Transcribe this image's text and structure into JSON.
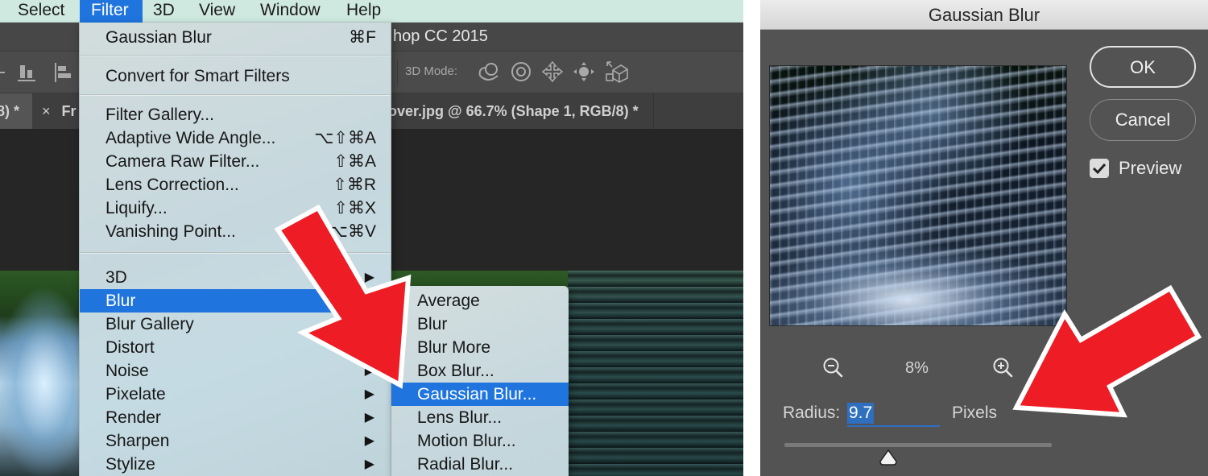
{
  "photoshop": {
    "menubar": {
      "items": [
        {
          "label": "Select",
          "active": false
        },
        {
          "label": "Filter",
          "active": true
        },
        {
          "label": "3D",
          "active": false
        },
        {
          "label": "View",
          "active": false
        },
        {
          "label": "Window",
          "active": false
        },
        {
          "label": "Help",
          "active": false
        }
      ]
    },
    "window_title": "hop CC 2015",
    "options_bar": {
      "mode_label": "3D Mode:",
      "icons": [
        "align-bottom-icon",
        "align-left-icon",
        "3d-orbit-icon",
        "3d-roll-icon",
        "3d-pan-icon",
        "3d-slide-icon",
        "3d-scale-icon"
      ]
    },
    "tabs": [
      {
        "label": "8) *",
        "close": ""
      },
      {
        "label": "Fr",
        "close": "×"
      },
      {
        "label": "over.jpg @ 66.7% (Shape 1, RGB/8) *",
        "close": ""
      }
    ],
    "filter_menu": {
      "last_filter": {
        "label": "Gaussian Blur",
        "shortcut": "⌘F"
      },
      "convert": {
        "label": "Convert for Smart Filters"
      },
      "group1": [
        {
          "label": "Filter Gallery...",
          "shortcut": ""
        },
        {
          "label": "Adaptive Wide Angle...",
          "shortcut": "⌥⇧⌘A"
        },
        {
          "label": "Camera Raw Filter...",
          "shortcut": "⇧⌘A"
        },
        {
          "label": "Lens Correction...",
          "shortcut": "⇧⌘R"
        },
        {
          "label": "Liquify...",
          "shortcut": "⇧⌘X"
        },
        {
          "label": "Vanishing Point...",
          "shortcut": "⌥⌘V"
        }
      ],
      "group2": [
        {
          "label": "3D",
          "submenu": true,
          "highlighted": false
        },
        {
          "label": "Blur",
          "submenu": true,
          "highlighted": true
        },
        {
          "label": "Blur Gallery",
          "submenu": true,
          "highlighted": false
        },
        {
          "label": "Distort",
          "submenu": true,
          "highlighted": false
        },
        {
          "label": "Noise",
          "submenu": true,
          "highlighted": false
        },
        {
          "label": "Pixelate",
          "submenu": true,
          "highlighted": false
        },
        {
          "label": "Render",
          "submenu": true,
          "highlighted": false
        },
        {
          "label": "Sharpen",
          "submenu": true,
          "highlighted": false
        },
        {
          "label": "Stylize",
          "submenu": true,
          "highlighted": false
        }
      ],
      "submenu_arrow": "▶"
    },
    "blur_submenu": [
      {
        "label": "Average",
        "highlighted": false
      },
      {
        "label": "Blur",
        "highlighted": false
      },
      {
        "label": "Blur More",
        "highlighted": false
      },
      {
        "label": "Box Blur...",
        "highlighted": false
      },
      {
        "label": "Gaussian Blur...",
        "highlighted": true
      },
      {
        "label": "Lens Blur...",
        "highlighted": false
      },
      {
        "label": "Motion Blur...",
        "highlighted": false
      },
      {
        "label": "Radial Blur...",
        "highlighted": false
      }
    ]
  },
  "dialog": {
    "title": "Gaussian Blur",
    "ok_label": "OK",
    "cancel_label": "Cancel",
    "preview_label": "Preview",
    "preview_checked": true,
    "zoom_percent": "8%",
    "radius_label": "Radius:",
    "radius_value": "9.7",
    "radius_unit": "Pixels",
    "slider_position_fraction": 0.39
  },
  "colors": {
    "menu_highlight": "#1f74de",
    "annotation_arrow": "#ee1c25",
    "dialog_bg": "#535353"
  }
}
